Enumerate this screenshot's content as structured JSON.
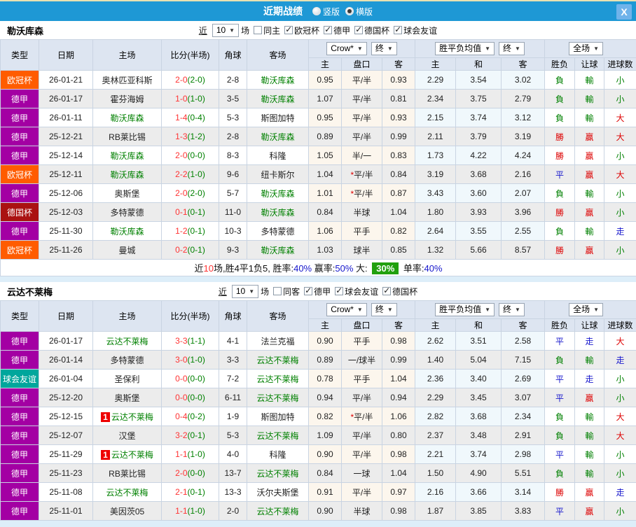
{
  "titlebar": {
    "title": "近期战绩",
    "vertical_label": "竖版",
    "horizontal_label": "横版",
    "horizontal_selected": true,
    "close": "X"
  },
  "colors": {
    "topbar": "#1e98d5",
    "orange": "#ff5c00",
    "purple": "#a300a3",
    "darkred": "#aa1212",
    "teal": "#00a69c",
    "green": "#008000",
    "red": "#dd0000",
    "blue": "#1616cc",
    "score": "#ff3333",
    "summary_green_bg": "#21a00e"
  },
  "sections": [
    {
      "team": "勒沃库森",
      "filter": {
        "prefix": "近",
        "count": "10",
        "suffix": "场",
        "same_label": "同主",
        "same_checked": false,
        "leagues": [
          "欧冠杯",
          "德甲",
          "德国杯",
          "球会友谊"
        ]
      },
      "head": {
        "cols": [
          "类型",
          "日期",
          "主场",
          "比分(半场)",
          "角球",
          "客场"
        ],
        "crow": "Crow*",
        "end": "终",
        "avg": "胜平负均值",
        "end2": "终",
        "full": "全场",
        "sub": [
          "主",
          "盘口",
          "客",
          "主",
          "和",
          "客",
          "胜负",
          "让球",
          "进球数"
        ]
      },
      "rows": [
        {
          "league": "欧冠杯",
          "lk": "orange",
          "date": "26-01-21",
          "home": "奥林匹亚科斯",
          "home_badge": "",
          "home_green": false,
          "score": "2-0",
          "half": "(2-0)",
          "corner": "2-8",
          "away": "勒沃库森",
          "away_green": true,
          "odds_home": "0.95",
          "handicap": "平/半",
          "handicap_star": false,
          "odds_away": "0.93",
          "avg_home": "2.29",
          "avg_draw": "3.54",
          "avg_away": "3.02",
          "results": [
            {
              "t": "負",
              "c": "g"
            },
            {
              "t": "輸",
              "c": "g"
            },
            {
              "t": "小",
              "c": "g"
            }
          ]
        },
        {
          "league": "德甲",
          "lk": "purple",
          "date": "26-01-17",
          "home": "霍芬海姆",
          "home_badge": "",
          "home_green": false,
          "score": "1-0",
          "half": "(1-0)",
          "corner": "3-5",
          "away": "勒沃库森",
          "away_green": true,
          "odds_home": "1.07",
          "handicap": "平/半",
          "handicap_star": false,
          "odds_away": "0.81",
          "avg_home": "2.34",
          "avg_draw": "3.75",
          "avg_away": "2.79",
          "results": [
            {
              "t": "負",
              "c": "g"
            },
            {
              "t": "輸",
              "c": "g"
            },
            {
              "t": "小",
              "c": "g"
            }
          ]
        },
        {
          "league": "德甲",
          "lk": "purple",
          "date": "26-01-11",
          "home": "勒沃库森",
          "home_badge": "",
          "home_green": true,
          "score": "1-4",
          "half": "(0-4)",
          "corner": "5-3",
          "away": "斯图加特",
          "away_green": false,
          "odds_home": "0.95",
          "handicap": "平/半",
          "handicap_star": false,
          "odds_away": "0.93",
          "avg_home": "2.15",
          "avg_draw": "3.74",
          "avg_away": "3.12",
          "results": [
            {
              "t": "負",
              "c": "g"
            },
            {
              "t": "輸",
              "c": "g"
            },
            {
              "t": "大",
              "c": "r"
            }
          ]
        },
        {
          "league": "德甲",
          "lk": "purple",
          "date": "25-12-21",
          "home": "RB莱比锡",
          "home_badge": "",
          "home_green": false,
          "score": "1-3",
          "half": "(1-2)",
          "corner": "2-8",
          "away": "勒沃库森",
          "away_green": true,
          "odds_home": "0.89",
          "handicap": "平/半",
          "handicap_star": false,
          "odds_away": "0.99",
          "avg_home": "2.11",
          "avg_draw": "3.79",
          "avg_away": "3.19",
          "results": [
            {
              "t": "勝",
              "c": "r"
            },
            {
              "t": "贏",
              "c": "r"
            },
            {
              "t": "大",
              "c": "r"
            }
          ]
        },
        {
          "league": "德甲",
          "lk": "purple",
          "date": "25-12-14",
          "home": "勒沃库森",
          "home_badge": "",
          "home_green": true,
          "score": "2-0",
          "half": "(0-0)",
          "corner": "8-3",
          "away": "科隆",
          "away_green": false,
          "odds_home": "1.05",
          "handicap": "半/一",
          "handicap_star": false,
          "odds_away": "0.83",
          "avg_home": "1.73",
          "avg_draw": "4.22",
          "avg_away": "4.24",
          "results": [
            {
              "t": "勝",
              "c": "r"
            },
            {
              "t": "贏",
              "c": "r"
            },
            {
              "t": "小",
              "c": "g"
            }
          ]
        },
        {
          "league": "欧冠杯",
          "lk": "orange",
          "date": "25-12-11",
          "home": "勒沃库森",
          "home_badge": "",
          "home_green": true,
          "score": "2-2",
          "half": "(1-0)",
          "corner": "9-6",
          "away": "纽卡斯尔",
          "away_green": false,
          "odds_home": "1.04",
          "handicap": "平/半",
          "handicap_star": true,
          "odds_away": "0.84",
          "avg_home": "3.19",
          "avg_draw": "3.68",
          "avg_away": "2.16",
          "results": [
            {
              "t": "平",
              "c": "b"
            },
            {
              "t": "贏",
              "c": "r"
            },
            {
              "t": "大",
              "c": "r"
            }
          ]
        },
        {
          "league": "德甲",
          "lk": "purple",
          "date": "25-12-06",
          "home": "奥斯堡",
          "home_badge": "",
          "home_green": false,
          "score": "2-0",
          "half": "(2-0)",
          "corner": "5-7",
          "away": "勒沃库森",
          "away_green": true,
          "odds_home": "1.01",
          "handicap": "平/半",
          "handicap_star": true,
          "odds_away": "0.87",
          "avg_home": "3.43",
          "avg_draw": "3.60",
          "avg_away": "2.07",
          "results": [
            {
              "t": "負",
              "c": "g"
            },
            {
              "t": "輸",
              "c": "g"
            },
            {
              "t": "小",
              "c": "g"
            }
          ]
        },
        {
          "league": "德国杯",
          "lk": "darkred",
          "date": "25-12-03",
          "home": "多特蒙德",
          "home_badge": "",
          "home_green": false,
          "score": "0-1",
          "half": "(0-1)",
          "corner": "11-0",
          "away": "勒沃库森",
          "away_green": true,
          "odds_home": "0.84",
          "handicap": "半球",
          "handicap_star": false,
          "odds_away": "1.04",
          "avg_home": "1.80",
          "avg_draw": "3.93",
          "avg_away": "3.96",
          "results": [
            {
              "t": "勝",
              "c": "r"
            },
            {
              "t": "贏",
              "c": "r"
            },
            {
              "t": "小",
              "c": "g"
            }
          ]
        },
        {
          "league": "德甲",
          "lk": "purple",
          "date": "25-11-30",
          "home": "勒沃库森",
          "home_badge": "",
          "home_green": true,
          "score": "1-2",
          "half": "(0-1)",
          "corner": "10-3",
          "away": "多特蒙德",
          "away_green": false,
          "odds_home": "1.06",
          "handicap": "平手",
          "handicap_star": false,
          "odds_away": "0.82",
          "avg_home": "2.64",
          "avg_draw": "3.55",
          "avg_away": "2.55",
          "results": [
            {
              "t": "負",
              "c": "g"
            },
            {
              "t": "輸",
              "c": "g"
            },
            {
              "t": "走",
              "c": "b"
            }
          ]
        },
        {
          "league": "欧冠杯",
          "lk": "orange",
          "date": "25-11-26",
          "home": "曼城",
          "home_badge": "",
          "home_green": false,
          "score": "0-2",
          "half": "(0-1)",
          "corner": "9-3",
          "away": "勒沃库森",
          "away_green": true,
          "odds_home": "1.03",
          "handicap": "球半",
          "handicap_star": false,
          "odds_away": "0.85",
          "avg_home": "1.32",
          "avg_draw": "5.66",
          "avg_away": "8.57",
          "results": [
            {
              "t": "勝",
              "c": "r"
            },
            {
              "t": "贏",
              "c": "r"
            },
            {
              "t": "小",
              "c": "g"
            }
          ]
        }
      ],
      "summary": [
        {
          "t": "近",
          "c": "k"
        },
        {
          "t": "10",
          "c": "r"
        },
        {
          "t": "场,胜4平1负5, 胜率:",
          "c": "k"
        },
        {
          "t": "40%",
          "c": "b"
        },
        {
          "t": " 赢率:",
          "c": "k"
        },
        {
          "t": "50%",
          "c": "b"
        },
        {
          "t": " 大: ",
          "c": "k"
        },
        {
          "t": "30%",
          "c": "wg"
        },
        {
          "t": " 单率:",
          "c": "k"
        },
        {
          "t": "40%",
          "c": "b"
        }
      ]
    },
    {
      "team": "云达不莱梅",
      "filter": {
        "prefix": "近",
        "count": "10",
        "suffix": "场",
        "same_label": "同客",
        "same_checked": false,
        "leagues": [
          "德甲",
          "球会友谊",
          "德国杯"
        ]
      },
      "head": {
        "cols": [
          "类型",
          "日期",
          "主场",
          "比分(半场)",
          "角球",
          "客场"
        ],
        "crow": "Crow*",
        "end": "终",
        "avg": "胜平负均值",
        "end2": "终",
        "full": "全场",
        "sub": [
          "主",
          "盘口",
          "客",
          "主",
          "和",
          "客",
          "胜负",
          "让球",
          "进球数"
        ]
      },
      "rows": [
        {
          "league": "德甲",
          "lk": "purple",
          "date": "26-01-17",
          "home": "云达不莱梅",
          "home_badge": "",
          "home_green": true,
          "score": "3-3",
          "half": "(1-1)",
          "corner": "4-1",
          "away": "法兰克福",
          "away_green": false,
          "odds_home": "0.90",
          "handicap": "平手",
          "handicap_star": false,
          "odds_away": "0.98",
          "avg_home": "2.62",
          "avg_draw": "3.51",
          "avg_away": "2.58",
          "results": [
            {
              "t": "平",
              "c": "b"
            },
            {
              "t": "走",
              "c": "b"
            },
            {
              "t": "大",
              "c": "r"
            }
          ]
        },
        {
          "league": "德甲",
          "lk": "purple",
          "date": "26-01-14",
          "home": "多特蒙德",
          "home_badge": "",
          "home_green": false,
          "score": "3-0",
          "half": "(1-0)",
          "corner": "3-3",
          "away": "云达不莱梅",
          "away_green": true,
          "odds_home": "0.89",
          "handicap": "一/球半",
          "handicap_star": false,
          "odds_away": "0.99",
          "avg_home": "1.40",
          "avg_draw": "5.04",
          "avg_away": "7.15",
          "results": [
            {
              "t": "負",
              "c": "g"
            },
            {
              "t": "輸",
              "c": "g"
            },
            {
              "t": "走",
              "c": "b"
            }
          ]
        },
        {
          "league": "球会友谊",
          "lk": "teal",
          "date": "26-01-04",
          "home": "圣保利",
          "home_badge": "",
          "home_green": false,
          "score": "0-0",
          "half": "(0-0)",
          "corner": "7-2",
          "away": "云达不莱梅",
          "away_green": true,
          "odds_home": "0.78",
          "handicap": "平手",
          "handicap_star": false,
          "odds_away": "1.04",
          "avg_home": "2.36",
          "avg_draw": "3.40",
          "avg_away": "2.69",
          "results": [
            {
              "t": "平",
              "c": "b"
            },
            {
              "t": "走",
              "c": "b"
            },
            {
              "t": "小",
              "c": "g"
            }
          ]
        },
        {
          "league": "德甲",
          "lk": "purple",
          "date": "25-12-20",
          "home": "奥斯堡",
          "home_badge": "",
          "home_green": false,
          "score": "0-0",
          "half": "(0-0)",
          "corner": "6-11",
          "away": "云达不莱梅",
          "away_green": true,
          "odds_home": "0.94",
          "handicap": "平/半",
          "handicap_star": false,
          "odds_away": "0.94",
          "avg_home": "2.29",
          "avg_draw": "3.45",
          "avg_away": "3.07",
          "results": [
            {
              "t": "平",
              "c": "b"
            },
            {
              "t": "贏",
              "c": "r"
            },
            {
              "t": "小",
              "c": "g"
            }
          ]
        },
        {
          "league": "德甲",
          "lk": "purple",
          "date": "25-12-15",
          "home": "云达不莱梅",
          "home_badge": "1",
          "home_green": true,
          "score": "0-4",
          "half": "(0-2)",
          "corner": "1-9",
          "away": "斯图加特",
          "away_green": false,
          "odds_home": "0.82",
          "handicap": "平/半",
          "handicap_star": true,
          "odds_away": "1.06",
          "avg_home": "2.82",
          "avg_draw": "3.68",
          "avg_away": "2.34",
          "results": [
            {
              "t": "負",
              "c": "g"
            },
            {
              "t": "輸",
              "c": "g"
            },
            {
              "t": "大",
              "c": "r"
            }
          ]
        },
        {
          "league": "德甲",
          "lk": "purple",
          "date": "25-12-07",
          "home": "汉堡",
          "home_badge": "",
          "home_green": false,
          "score": "3-2",
          "half": "(0-1)",
          "corner": "5-3",
          "away": "云达不莱梅",
          "away_green": true,
          "odds_home": "1.09",
          "handicap": "平/半",
          "handicap_star": false,
          "odds_away": "0.80",
          "avg_home": "2.37",
          "avg_draw": "3.48",
          "avg_away": "2.91",
          "results": [
            {
              "t": "負",
              "c": "g"
            },
            {
              "t": "輸",
              "c": "g"
            },
            {
              "t": "大",
              "c": "r"
            }
          ]
        },
        {
          "league": "德甲",
          "lk": "purple",
          "date": "25-11-29",
          "home": "云达不莱梅",
          "home_badge": "1",
          "home_green": true,
          "score": "1-1",
          "half": "(1-0)",
          "corner": "4-0",
          "away": "科隆",
          "away_green": false,
          "odds_home": "0.90",
          "handicap": "平/半",
          "handicap_star": false,
          "odds_away": "0.98",
          "avg_home": "2.21",
          "avg_draw": "3.74",
          "avg_away": "2.98",
          "results": [
            {
              "t": "平",
              "c": "b"
            },
            {
              "t": "輸",
              "c": "g"
            },
            {
              "t": "小",
              "c": "g"
            }
          ]
        },
        {
          "league": "德甲",
          "lk": "purple",
          "date": "25-11-23",
          "home": "RB莱比锡",
          "home_badge": "",
          "home_green": false,
          "score": "2-0",
          "half": "(0-0)",
          "corner": "13-7",
          "away": "云达不莱梅",
          "away_green": true,
          "odds_home": "0.84",
          "handicap": "一球",
          "handicap_star": false,
          "odds_away": "1.04",
          "avg_home": "1.50",
          "avg_draw": "4.90",
          "avg_away": "5.51",
          "results": [
            {
              "t": "負",
              "c": "g"
            },
            {
              "t": "輸",
              "c": "g"
            },
            {
              "t": "小",
              "c": "g"
            }
          ]
        },
        {
          "league": "德甲",
          "lk": "purple",
          "date": "25-11-08",
          "home": "云达不莱梅",
          "home_badge": "",
          "home_green": true,
          "score": "2-1",
          "half": "(0-1)",
          "corner": "13-3",
          "away": "沃尔夫斯堡",
          "away_green": false,
          "odds_home": "0.91",
          "handicap": "平/半",
          "handicap_star": false,
          "odds_away": "0.97",
          "avg_home": "2.16",
          "avg_draw": "3.66",
          "avg_away": "3.14",
          "results": [
            {
              "t": "勝",
              "c": "r"
            },
            {
              "t": "贏",
              "c": "r"
            },
            {
              "t": "走",
              "c": "b"
            }
          ]
        },
        {
          "league": "德甲",
          "lk": "purple",
          "date": "25-11-01",
          "home": "美因茨05",
          "home_badge": "",
          "home_green": false,
          "score": "1-1",
          "half": "(1-0)",
          "corner": "2-0",
          "away": "云达不莱梅",
          "away_green": true,
          "odds_home": "0.90",
          "handicap": "半球",
          "handicap_star": false,
          "odds_away": "0.98",
          "avg_home": "1.87",
          "avg_draw": "3.85",
          "avg_away": "3.83",
          "results": [
            {
              "t": "平",
              "c": "b"
            },
            {
              "t": "贏",
              "c": "r"
            },
            {
              "t": "小",
              "c": "g"
            }
          ]
        }
      ],
      "summary": null
    }
  ]
}
